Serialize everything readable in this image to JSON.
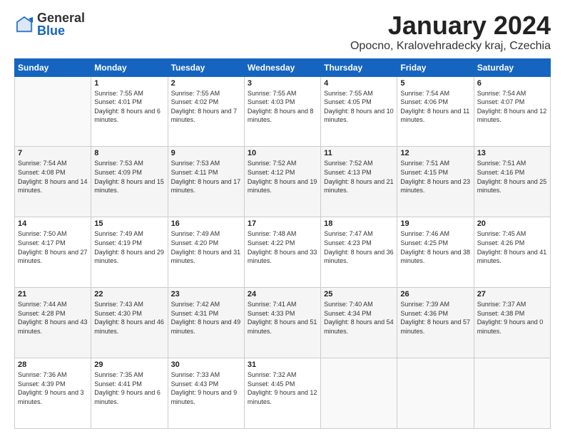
{
  "logo": {
    "general": "General",
    "blue": "Blue"
  },
  "title": "January 2024",
  "location": "Opocno, Kralovehradecky kraj, Czechia",
  "weekdays": [
    "Sunday",
    "Monday",
    "Tuesday",
    "Wednesday",
    "Thursday",
    "Friday",
    "Saturday"
  ],
  "weeks": [
    [
      {
        "day": "",
        "sunrise": "",
        "sunset": "",
        "daylight": ""
      },
      {
        "day": "1",
        "sunrise": "Sunrise: 7:55 AM",
        "sunset": "Sunset: 4:01 PM",
        "daylight": "Daylight: 8 hours and 6 minutes."
      },
      {
        "day": "2",
        "sunrise": "Sunrise: 7:55 AM",
        "sunset": "Sunset: 4:02 PM",
        "daylight": "Daylight: 8 hours and 7 minutes."
      },
      {
        "day": "3",
        "sunrise": "Sunrise: 7:55 AM",
        "sunset": "Sunset: 4:03 PM",
        "daylight": "Daylight: 8 hours and 8 minutes."
      },
      {
        "day": "4",
        "sunrise": "Sunrise: 7:55 AM",
        "sunset": "Sunset: 4:05 PM",
        "daylight": "Daylight: 8 hours and 10 minutes."
      },
      {
        "day": "5",
        "sunrise": "Sunrise: 7:54 AM",
        "sunset": "Sunset: 4:06 PM",
        "daylight": "Daylight: 8 hours and 11 minutes."
      },
      {
        "day": "6",
        "sunrise": "Sunrise: 7:54 AM",
        "sunset": "Sunset: 4:07 PM",
        "daylight": "Daylight: 8 hours and 12 minutes."
      }
    ],
    [
      {
        "day": "7",
        "sunrise": "Sunrise: 7:54 AM",
        "sunset": "Sunset: 4:08 PM",
        "daylight": "Daylight: 8 hours and 14 minutes."
      },
      {
        "day": "8",
        "sunrise": "Sunrise: 7:53 AM",
        "sunset": "Sunset: 4:09 PM",
        "daylight": "Daylight: 8 hours and 15 minutes."
      },
      {
        "day": "9",
        "sunrise": "Sunrise: 7:53 AM",
        "sunset": "Sunset: 4:11 PM",
        "daylight": "Daylight: 8 hours and 17 minutes."
      },
      {
        "day": "10",
        "sunrise": "Sunrise: 7:52 AM",
        "sunset": "Sunset: 4:12 PM",
        "daylight": "Daylight: 8 hours and 19 minutes."
      },
      {
        "day": "11",
        "sunrise": "Sunrise: 7:52 AM",
        "sunset": "Sunset: 4:13 PM",
        "daylight": "Daylight: 8 hours and 21 minutes."
      },
      {
        "day": "12",
        "sunrise": "Sunrise: 7:51 AM",
        "sunset": "Sunset: 4:15 PM",
        "daylight": "Daylight: 8 hours and 23 minutes."
      },
      {
        "day": "13",
        "sunrise": "Sunrise: 7:51 AM",
        "sunset": "Sunset: 4:16 PM",
        "daylight": "Daylight: 8 hours and 25 minutes."
      }
    ],
    [
      {
        "day": "14",
        "sunrise": "Sunrise: 7:50 AM",
        "sunset": "Sunset: 4:17 PM",
        "daylight": "Daylight: 8 hours and 27 minutes."
      },
      {
        "day": "15",
        "sunrise": "Sunrise: 7:49 AM",
        "sunset": "Sunset: 4:19 PM",
        "daylight": "Daylight: 8 hours and 29 minutes."
      },
      {
        "day": "16",
        "sunrise": "Sunrise: 7:49 AM",
        "sunset": "Sunset: 4:20 PM",
        "daylight": "Daylight: 8 hours and 31 minutes."
      },
      {
        "day": "17",
        "sunrise": "Sunrise: 7:48 AM",
        "sunset": "Sunset: 4:22 PM",
        "daylight": "Daylight: 8 hours and 33 minutes."
      },
      {
        "day": "18",
        "sunrise": "Sunrise: 7:47 AM",
        "sunset": "Sunset: 4:23 PM",
        "daylight": "Daylight: 8 hours and 36 minutes."
      },
      {
        "day": "19",
        "sunrise": "Sunrise: 7:46 AM",
        "sunset": "Sunset: 4:25 PM",
        "daylight": "Daylight: 8 hours and 38 minutes."
      },
      {
        "day": "20",
        "sunrise": "Sunrise: 7:45 AM",
        "sunset": "Sunset: 4:26 PM",
        "daylight": "Daylight: 8 hours and 41 minutes."
      }
    ],
    [
      {
        "day": "21",
        "sunrise": "Sunrise: 7:44 AM",
        "sunset": "Sunset: 4:28 PM",
        "daylight": "Daylight: 8 hours and 43 minutes."
      },
      {
        "day": "22",
        "sunrise": "Sunrise: 7:43 AM",
        "sunset": "Sunset: 4:30 PM",
        "daylight": "Daylight: 8 hours and 46 minutes."
      },
      {
        "day": "23",
        "sunrise": "Sunrise: 7:42 AM",
        "sunset": "Sunset: 4:31 PM",
        "daylight": "Daylight: 8 hours and 49 minutes."
      },
      {
        "day": "24",
        "sunrise": "Sunrise: 7:41 AM",
        "sunset": "Sunset: 4:33 PM",
        "daylight": "Daylight: 8 hours and 51 minutes."
      },
      {
        "day": "25",
        "sunrise": "Sunrise: 7:40 AM",
        "sunset": "Sunset: 4:34 PM",
        "daylight": "Daylight: 8 hours and 54 minutes."
      },
      {
        "day": "26",
        "sunrise": "Sunrise: 7:39 AM",
        "sunset": "Sunset: 4:36 PM",
        "daylight": "Daylight: 8 hours and 57 minutes."
      },
      {
        "day": "27",
        "sunrise": "Sunrise: 7:37 AM",
        "sunset": "Sunset: 4:38 PM",
        "daylight": "Daylight: 9 hours and 0 minutes."
      }
    ],
    [
      {
        "day": "28",
        "sunrise": "Sunrise: 7:36 AM",
        "sunset": "Sunset: 4:39 PM",
        "daylight": "Daylight: 9 hours and 3 minutes."
      },
      {
        "day": "29",
        "sunrise": "Sunrise: 7:35 AM",
        "sunset": "Sunset: 4:41 PM",
        "daylight": "Daylight: 9 hours and 6 minutes."
      },
      {
        "day": "30",
        "sunrise": "Sunrise: 7:33 AM",
        "sunset": "Sunset: 4:43 PM",
        "daylight": "Daylight: 9 hours and 9 minutes."
      },
      {
        "day": "31",
        "sunrise": "Sunrise: 7:32 AM",
        "sunset": "Sunset: 4:45 PM",
        "daylight": "Daylight: 9 hours and 12 minutes."
      },
      {
        "day": "",
        "sunrise": "",
        "sunset": "",
        "daylight": ""
      },
      {
        "day": "",
        "sunrise": "",
        "sunset": "",
        "daylight": ""
      },
      {
        "day": "",
        "sunrise": "",
        "sunset": "",
        "daylight": ""
      }
    ]
  ]
}
